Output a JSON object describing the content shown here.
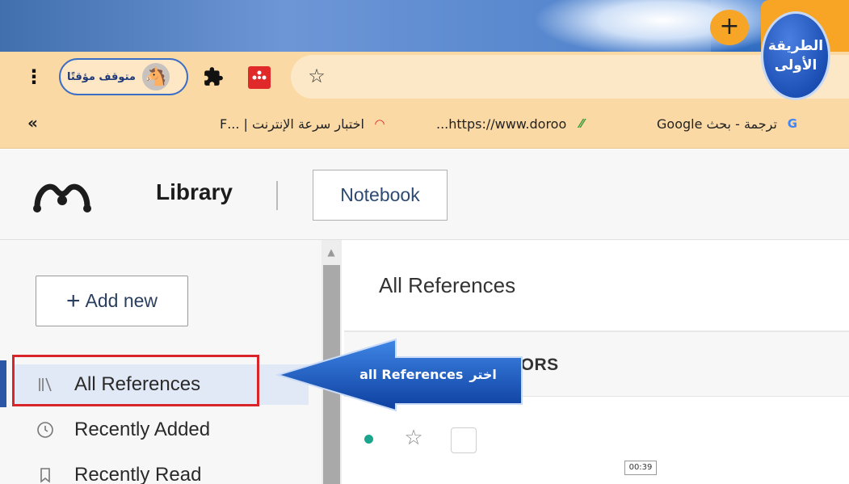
{
  "browser": {
    "new_tab_label": "+",
    "profile": {
      "label": "متوقف مؤقتًا",
      "avatar_icon": "horse-icon"
    },
    "extensions": [
      {
        "name": "puzzle-icon",
        "glyph": "✱"
      },
      {
        "name": "mendeley-extension-icon",
        "glyph": "M"
      }
    ],
    "bookmarks": {
      "more_label": "«",
      "items": [
        {
          "label": "ترجمة - بحث Google",
          "icon": "G",
          "icon_color": "#4285f4"
        },
        {
          "label": "https://www.doroo...",
          "icon": "⟋",
          "icon_color": "#3a9a3a"
        },
        {
          "label": "اختبار سرعة الإنترنت | ...F",
          "icon": "◠",
          "icon_color": "#d8252a"
        }
      ]
    }
  },
  "corner_badge": {
    "line1": "الطريقة",
    "line2": "الأولى"
  },
  "app": {
    "title": "Library",
    "notebook_label": "Notebook",
    "add_new_label": "Add new",
    "nav": [
      {
        "id": "all-references",
        "label": "All References",
        "icon": "library-icon",
        "active": true
      },
      {
        "id": "recently-added",
        "label": "Recently Added",
        "icon": "clock-icon",
        "active": false
      },
      {
        "id": "recently-read",
        "label": "Recently Read",
        "icon": "bookmark-icon",
        "active": false
      }
    ],
    "main": {
      "title": "All References",
      "column_header": "UTHORS"
    }
  },
  "annotation": {
    "arabic": "اختر",
    "english": "all References"
  },
  "timestamp": "00:39",
  "colors": {
    "accent": "#2c57a6",
    "highlight_red": "#d8252a",
    "toolbar_bg": "#fbd9a5",
    "status_dot": "#1ba58c"
  }
}
